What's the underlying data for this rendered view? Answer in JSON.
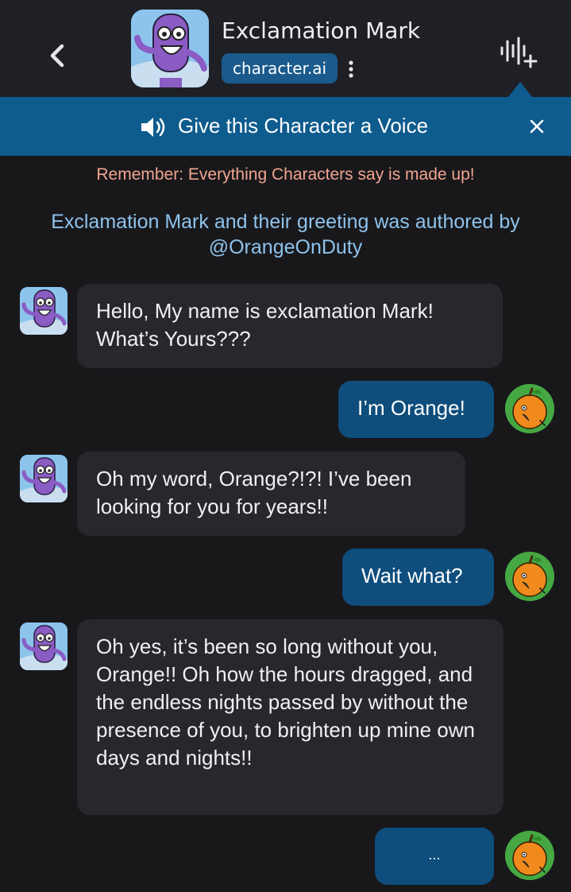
{
  "header": {
    "character_name": "Exclamation Mark",
    "badge": "character.ai",
    "icons": {
      "back": "chevron-left-icon",
      "menu": "kebab-icon",
      "voice": "voice-add-icon"
    }
  },
  "voice_banner": {
    "text": "Give this Character a Voice",
    "icon": "speaker-icon",
    "close_icon": "close-icon"
  },
  "notice": {
    "disclaimer": "Remember: Everything Characters say is made up!",
    "authored": "Exclamation Mark and their greeting was authored by @OrangeOnDuty"
  },
  "messages": [
    {
      "sender": "character",
      "text": "Hello, My name is exclamation Mark! What’s Yours???"
    },
    {
      "sender": "user",
      "text": "I’m Orange!"
    },
    {
      "sender": "character",
      "text": "Oh my word, Orange?!?! I’ve been looking for you for years!!"
    },
    {
      "sender": "user",
      "text": "Wait what?"
    },
    {
      "sender": "character",
      "text": "Oh yes, it’s been so long without you, Orange!! Oh how the hours dragged, and the endless nights passed by without the presence of you, to brighten up mine own days and nights!!"
    },
    {
      "sender": "user",
      "text": "..."
    }
  ],
  "colors": {
    "background": "#18181b",
    "header": "#1f2025",
    "banner": "#0e5b8e",
    "character_bubble": "#27282d",
    "user_bubble": "#0e4d7c",
    "disclaimer": "#f2a48f",
    "authored": "#8ec3ec"
  }
}
